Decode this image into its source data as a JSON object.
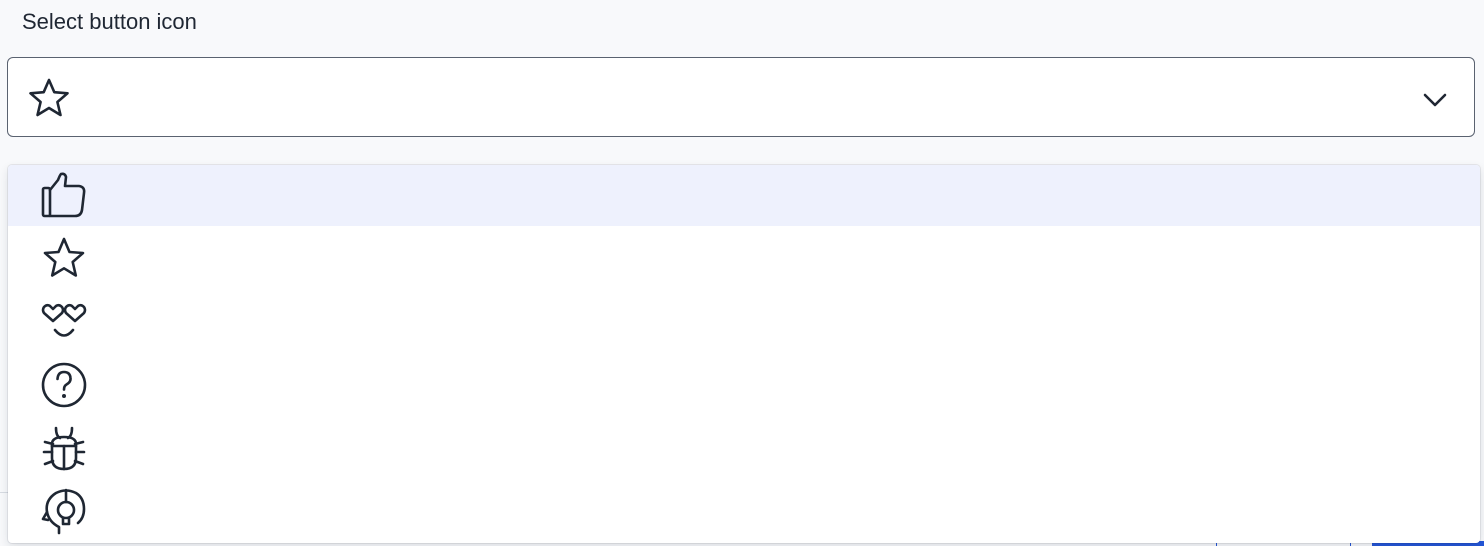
{
  "field": {
    "label": "Select button icon",
    "selected_icon": "star-icon"
  },
  "dropdown": {
    "highlighted_index": 0,
    "options": [
      {
        "icon": "thumbs-up-icon"
      },
      {
        "icon": "star-icon"
      },
      {
        "icon": "heart-eyes-smile-icon"
      },
      {
        "icon": "question-circle-icon"
      },
      {
        "icon": "bug-icon"
      },
      {
        "icon": "head-lightbulb-icon"
      }
    ]
  },
  "colors": {
    "icon_stroke": "#1f2733",
    "highlight": "#eef1fd",
    "border": "#5a6270",
    "accent": "#2456d8"
  }
}
